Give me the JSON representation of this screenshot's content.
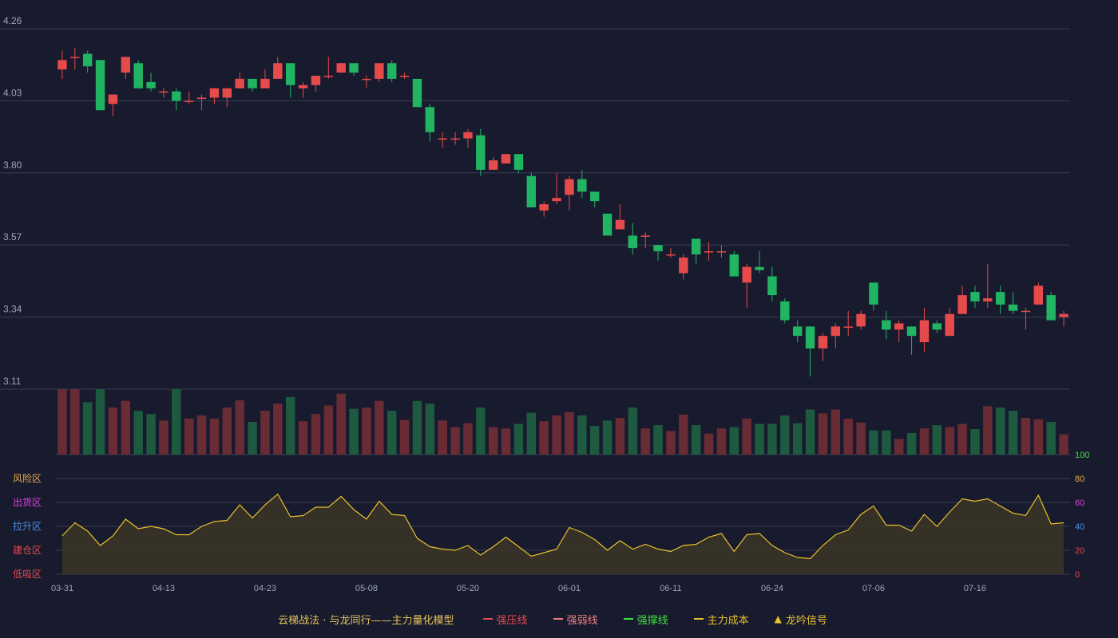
{
  "colors": {
    "background": "#181a2e",
    "grid": "#3a3c52",
    "up": "#e64b4b",
    "down": "#21b563",
    "vol_up": "#6a2c34",
    "vol_down": "#1d5a40",
    "line": "#e8c12d",
    "area": "#3a3426",
    "axis_text": "#a0a4b8",
    "zone_risk": "#e8a84a",
    "zone_sell": "#e040e0",
    "zone_pull": "#4a90e8",
    "zone_build": "#e84a4a",
    "zone_low": "#e84a4a",
    "tick_100": "#40e040",
    "tick_80": "#e8a84a",
    "tick_60": "#e040e0",
    "tick_40": "#4a90e8",
    "tick_20": "#e84a4a",
    "tick_0": "#e84a4a"
  },
  "legend": {
    "title": "云梯战法 · 与龙同行——主力量化模型",
    "items": [
      {
        "label": "强压线",
        "color": "#e64b4b",
        "style": "solid"
      },
      {
        "label": "强弱线",
        "color": "#f08080",
        "style": "dash"
      },
      {
        "label": "强撑线",
        "color": "#40e040",
        "style": "solid"
      },
      {
        "label": "主力成本",
        "color": "#e8c12d",
        "style": "dash"
      },
      {
        "label": "龙吟信号",
        "color": "#e8c12d",
        "style": "triangle"
      }
    ]
  },
  "chart_data": {
    "type": "candlestick",
    "price_axis": {
      "ticks": [
        "4.26",
        "4.03",
        "3.80",
        "3.57",
        "3.34",
        "3.11"
      ],
      "ylim": [
        3.11,
        4.26
      ]
    },
    "indicator_axis": {
      "ticks": [
        "100",
        "80",
        "60",
        "40",
        "20",
        "0"
      ],
      "ylim": [
        0,
        100
      ]
    },
    "zones": [
      "风险区",
      "出货区",
      "拉升区",
      "建仓区",
      "低吸区"
    ],
    "x_ticks": [
      "03-31",
      "04-13",
      "04-23",
      "05-08",
      "05-20",
      "06-01",
      "06-11",
      "06-24",
      "07-06",
      "07-16"
    ],
    "x_tick_index": [
      0,
      8,
      16,
      24,
      32,
      40,
      48,
      56,
      64,
      72
    ],
    "candles": [
      [
        4.13,
        4.16,
        4.1,
        4.19
      ],
      [
        4.17,
        4.17,
        4.13,
        4.2
      ],
      [
        4.18,
        4.14,
        4.12,
        4.19
      ],
      [
        4.16,
        4.0,
        4.0,
        4.16
      ],
      [
        4.02,
        4.05,
        3.98,
        4.05
      ],
      [
        4.12,
        4.17,
        4.1,
        4.17
      ],
      [
        4.15,
        4.07,
        4.07,
        4.16
      ],
      [
        4.09,
        4.07,
        4.06,
        4.12
      ],
      [
        4.06,
        4.06,
        4.04,
        4.07
      ],
      [
        4.06,
        4.03,
        4.0,
        4.07
      ],
      [
        4.03,
        4.03,
        4.02,
        4.06
      ],
      [
        4.04,
        4.04,
        4.0,
        4.05
      ],
      [
        4.04,
        4.07,
        4.02,
        4.07
      ],
      [
        4.04,
        4.07,
        4.01,
        4.07
      ],
      [
        4.07,
        4.1,
        4.07,
        4.12
      ],
      [
        4.1,
        4.07,
        4.06,
        4.1
      ],
      [
        4.07,
        4.1,
        4.07,
        4.13
      ],
      [
        4.1,
        4.15,
        4.1,
        4.17
      ],
      [
        4.15,
        4.08,
        4.04,
        4.15
      ],
      [
        4.07,
        4.08,
        4.04,
        4.09
      ],
      [
        4.08,
        4.11,
        4.06,
        4.11
      ],
      [
        4.11,
        4.11,
        4.1,
        4.17
      ],
      [
        4.12,
        4.15,
        4.12,
        4.15
      ],
      [
        4.15,
        4.12,
        4.11,
        4.15
      ],
      [
        4.1,
        4.1,
        4.07,
        4.11
      ],
      [
        4.1,
        4.15,
        4.09,
        4.15
      ],
      [
        4.15,
        4.1,
        4.09,
        4.16
      ],
      [
        4.11,
        4.11,
        4.1,
        4.12
      ],
      [
        4.1,
        4.01,
        4.01,
        4.1
      ],
      [
        4.01,
        3.93,
        3.9,
        4.02
      ],
      [
        3.91,
        3.91,
        3.88,
        3.93
      ],
      [
        3.91,
        3.91,
        3.89,
        3.93
      ],
      [
        3.91,
        3.93,
        3.88,
        3.94
      ],
      [
        3.92,
        3.81,
        3.79,
        3.94
      ],
      [
        3.81,
        3.84,
        3.81,
        3.85
      ],
      [
        3.83,
        3.86,
        3.83,
        3.86
      ],
      [
        3.86,
        3.81,
        3.8,
        3.86
      ],
      [
        3.79,
        3.69,
        3.69,
        3.8
      ],
      [
        3.68,
        3.7,
        3.66,
        3.71
      ],
      [
        3.71,
        3.72,
        3.7,
        3.8
      ],
      [
        3.73,
        3.78,
        3.68,
        3.79
      ],
      [
        3.78,
        3.74,
        3.72,
        3.81
      ],
      [
        3.74,
        3.71,
        3.69,
        3.74
      ],
      [
        3.67,
        3.6,
        3.6,
        3.67
      ],
      [
        3.62,
        3.65,
        3.62,
        3.7
      ],
      [
        3.6,
        3.56,
        3.54,
        3.64
      ],
      [
        3.6,
        3.6,
        3.56,
        3.61
      ],
      [
        3.57,
        3.55,
        3.52,
        3.57
      ],
      [
        3.54,
        3.54,
        3.53,
        3.56
      ],
      [
        3.48,
        3.53,
        3.46,
        3.54
      ],
      [
        3.59,
        3.54,
        3.51,
        3.59
      ],
      [
        3.55,
        3.55,
        3.52,
        3.58
      ],
      [
        3.55,
        3.55,
        3.53,
        3.57
      ],
      [
        3.54,
        3.47,
        3.47,
        3.55
      ],
      [
        3.45,
        3.5,
        3.37,
        3.51
      ],
      [
        3.5,
        3.49,
        3.48,
        3.55
      ],
      [
        3.47,
        3.41,
        3.39,
        3.5
      ],
      [
        3.39,
        3.33,
        3.32,
        3.4
      ],
      [
        3.31,
        3.28,
        3.26,
        3.33
      ],
      [
        3.31,
        3.24,
        3.15,
        3.31
      ],
      [
        3.24,
        3.28,
        3.2,
        3.29
      ],
      [
        3.28,
        3.31,
        3.24,
        3.32
      ],
      [
        3.31,
        3.31,
        3.28,
        3.36
      ],
      [
        3.31,
        3.35,
        3.3,
        3.36
      ],
      [
        3.45,
        3.38,
        3.36,
        3.45
      ],
      [
        3.33,
        3.3,
        3.27,
        3.36
      ],
      [
        3.3,
        3.32,
        3.26,
        3.33
      ],
      [
        3.31,
        3.28,
        3.22,
        3.31
      ],
      [
        3.26,
        3.33,
        3.23,
        3.37
      ],
      [
        3.32,
        3.3,
        3.29,
        3.33
      ],
      [
        3.28,
        3.35,
        3.28,
        3.37
      ],
      [
        3.35,
        3.41,
        3.35,
        3.44
      ],
      [
        3.42,
        3.39,
        3.37,
        3.44
      ],
      [
        3.39,
        3.4,
        3.37,
        3.51
      ],
      [
        3.42,
        3.38,
        3.35,
        3.44
      ],
      [
        3.38,
        3.36,
        3.35,
        3.42
      ],
      [
        3.36,
        3.36,
        3.3,
        3.37
      ],
      [
        3.38,
        3.44,
        3.38,
        3.45
      ],
      [
        3.41,
        3.33,
        3.33,
        3.42
      ],
      [
        3.34,
        3.35,
        3.31,
        3.36
      ]
    ],
    "volume": [
      100,
      100,
      80,
      100,
      72,
      82,
      67,
      62,
      52,
      100,
      55,
      60,
      55,
      72,
      83,
      50,
      67,
      78,
      88,
      51,
      62,
      75,
      93,
      70,
      72,
      82,
      67,
      53,
      82,
      78,
      52,
      42,
      48,
      72,
      42,
      40,
      47,
      64,
      51,
      60,
      65,
      60,
      44,
      52,
      56,
      72,
      40,
      45,
      36,
      61,
      45,
      32,
      40,
      42,
      55,
      47,
      47,
      60,
      48,
      69,
      63,
      69,
      55,
      49,
      37,
      37,
      24,
      33,
      40,
      45,
      42,
      47,
      39,
      74,
      72,
      67,
      56,
      54,
      50,
      31
    ],
    "indicator": [
      32,
      43,
      36,
      24,
      32,
      46,
      38,
      40,
      38,
      33,
      33,
      40,
      44,
      45,
      58,
      47,
      58,
      67,
      48,
      49,
      56,
      56,
      65,
      54,
      46,
      61,
      50,
      49,
      30,
      23,
      21,
      20,
      24,
      16,
      23,
      31,
      23,
      15,
      18,
      21,
      39,
      35,
      29,
      20,
      28,
      21,
      25,
      21,
      19,
      24,
      25,
      31,
      34,
      19,
      33,
      34,
      24,
      18,
      14,
      13,
      24,
      33,
      37,
      50,
      57,
      41,
      41,
      36,
      50,
      40,
      52,
      63,
      61,
      63,
      57,
      51,
      49,
      66,
      42,
      43
    ]
  }
}
